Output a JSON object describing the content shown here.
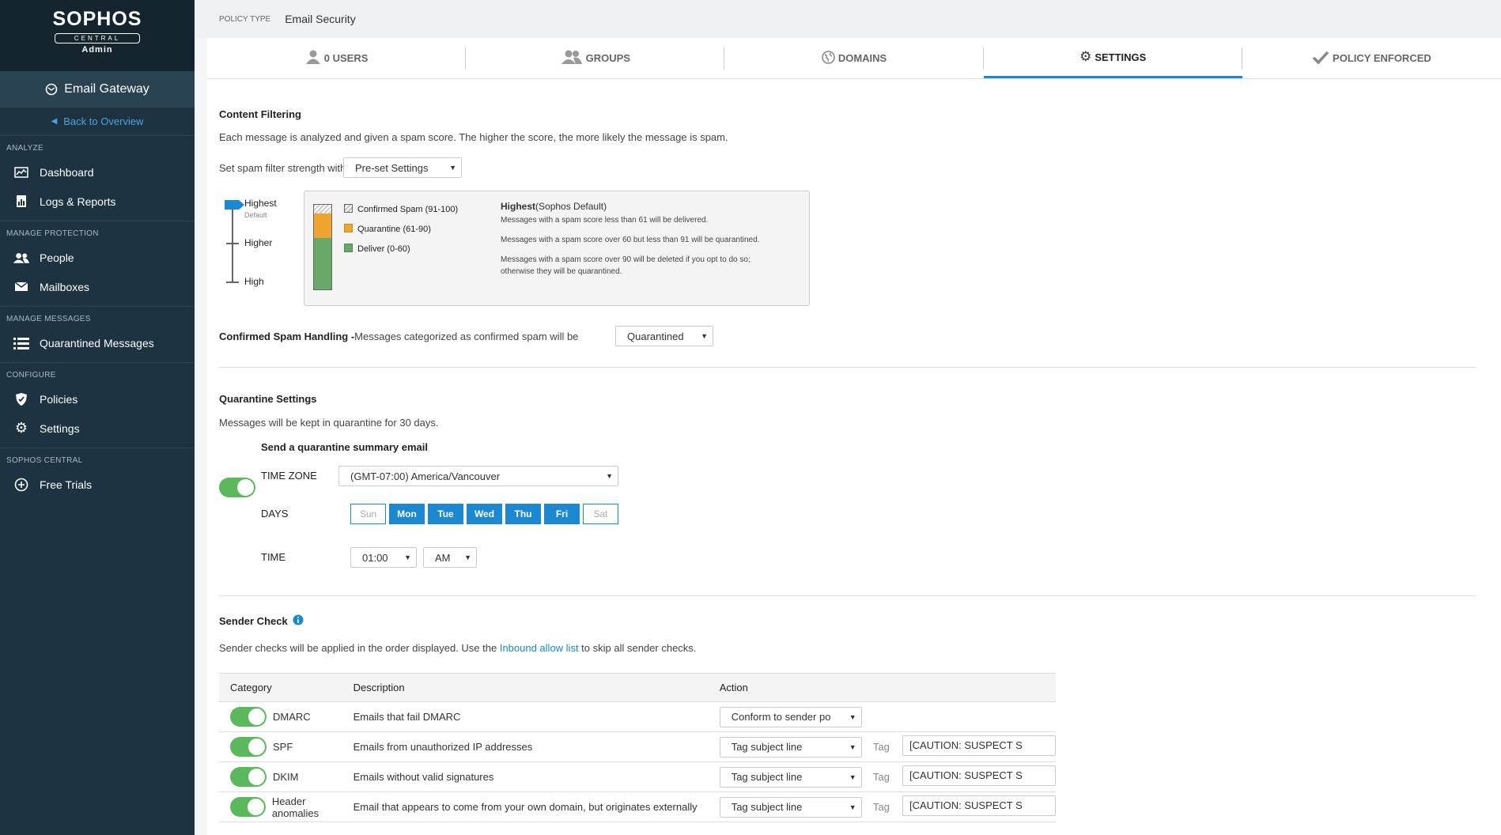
{
  "sidebar": {
    "brand": "SOPHOS",
    "brand_sub": "CENTRAL",
    "role": "Admin",
    "product": "Email Gateway",
    "back": "Back to Overview",
    "sections": [
      {
        "title": "ANALYZE",
        "items": [
          {
            "label": "Dashboard",
            "icon": "dashboard-icon"
          },
          {
            "label": "Logs & Reports",
            "icon": "reports-icon"
          }
        ]
      },
      {
        "title": "MANAGE PROTECTION",
        "items": [
          {
            "label": "People",
            "icon": "people-icon"
          },
          {
            "label": "Mailboxes",
            "icon": "mailbox-icon"
          }
        ]
      },
      {
        "title": "MANAGE MESSAGES",
        "items": [
          {
            "label": "Quarantined Messages",
            "icon": "list-icon"
          }
        ]
      },
      {
        "title": "CONFIGURE",
        "items": [
          {
            "label": "Policies",
            "icon": "shield-icon"
          },
          {
            "label": "Settings",
            "icon": "gear-icon"
          }
        ]
      },
      {
        "title": "SOPHOS CENTRAL",
        "items": [
          {
            "label": "Free Trials",
            "icon": "plus-circle-icon"
          }
        ]
      }
    ]
  },
  "policy": {
    "type_label": "POLICY TYPE",
    "type_value": "Email Security"
  },
  "tabs": [
    "0 USERS",
    "GROUPS",
    "DOMAINS",
    "SETTINGS",
    "POLICY ENFORCED"
  ],
  "active_tab": "SETTINGS",
  "content_filtering": {
    "title": "Content Filtering",
    "desc": "Each message is analyzed and given a spam score. The higher the score, the more likely the message is spam.",
    "strength_label": "Set spam filter strength with",
    "strength_select": "Pre-set Settings",
    "levels": {
      "highest": "Highest",
      "default": "Default",
      "higher": "Higher",
      "high": "High"
    },
    "legend": {
      "confirmed": "Confirmed Spam (91-100)",
      "quarantine": "Quarantine (61-90)",
      "deliver": "Deliver (0-60)"
    },
    "detail_title": "Highest",
    "detail_title_suffix": "(Sophos Default)",
    "detail_lines": [
      "Messages with a spam score less than 61 will be delivered.",
      "Messages with a spam score over 60 but less than 91 will be quarantined.",
      "Messages with a spam score over 90 will be deleted if you opt to do so;",
      "otherwise they will be quarantined."
    ],
    "colors": {
      "quarantine": "#f0a430",
      "deliver": "#6aa86a"
    }
  },
  "confirmed_spam": {
    "label": "Confirmed Spam Handling -",
    "text": "Messages categorized as confirmed spam will be",
    "select": "Quarantined"
  },
  "quarantine": {
    "title": "Quarantine Settings",
    "desc": "Messages will be kept in quarantine for 30 days.",
    "summary_label": "Send a quarantine summary email",
    "timezone_label": "TIME ZONE",
    "timezone": "(GMT-07:00) America/Vancouver",
    "days_label": "DAYS",
    "days": [
      {
        "d": "Sun",
        "on": false
      },
      {
        "d": "Mon",
        "on": true
      },
      {
        "d": "Tue",
        "on": true
      },
      {
        "d": "Wed",
        "on": true
      },
      {
        "d": "Thu",
        "on": true
      },
      {
        "d": "Fri",
        "on": true
      },
      {
        "d": "Sat",
        "on": false
      }
    ],
    "time_label": "TIME",
    "time": "01:00",
    "ampm": "AM"
  },
  "sender_check": {
    "title": "Sender Check",
    "desc_before": "Sender checks will be applied in the order displayed. Use the ",
    "link": "Inbound allow list",
    "desc_after": " to skip all sender checks.",
    "columns": [
      "Category",
      "Description",
      "Action"
    ],
    "tag_label": "Tag",
    "rows": [
      {
        "category": "DMARC",
        "description": "Emails that fail DMARC",
        "action": "Conform to sender po",
        "tag": ""
      },
      {
        "category": "SPF",
        "description": "Emails from unauthorized IP addresses",
        "action": "Tag subject line",
        "tag": "[CAUTION: SUSPECT S"
      },
      {
        "category": "DKIM",
        "description": "Emails without valid signatures",
        "action": "Tag subject line",
        "tag": "[CAUTION: SUSPECT S"
      },
      {
        "category": "Header anomalies",
        "description": "Email that appears to come from your own domain, but originates externally",
        "action": "Tag subject line",
        "tag": "[CAUTION: SUSPECT S"
      }
    ]
  }
}
